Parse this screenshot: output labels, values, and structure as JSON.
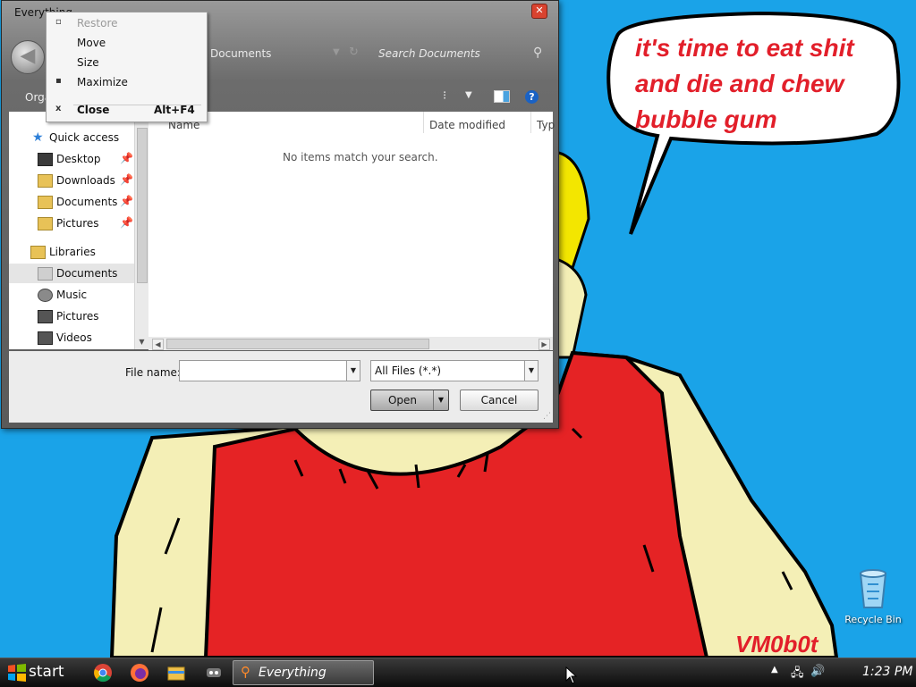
{
  "desktop": {
    "speech_bubble": [
      "it's time to eat shit",
      "and die and chew",
      "bubble gum"
    ],
    "watermark": "VM0b0t",
    "recycle_bin_label": "Recycle Bin"
  },
  "dialog": {
    "title": "Everything",
    "address": "Documents",
    "search_placeholder": "Search Documents",
    "organize_label": "Orga",
    "nav": [
      {
        "label": "Quick access",
        "icon": "star-icon"
      },
      {
        "label": "Desktop",
        "icon": "desktop-icon",
        "pinned": true
      },
      {
        "label": "Downloads",
        "icon": "downloads-icon",
        "pinned": true
      },
      {
        "label": "Documents",
        "icon": "documents-icon",
        "pinned": true
      },
      {
        "label": "Pictures",
        "icon": "pictures-icon",
        "pinned": true
      },
      {
        "label": "Libraries",
        "icon": "libraries-icon"
      },
      {
        "label": "Documents",
        "icon": "documents-library-icon",
        "selected": true
      },
      {
        "label": "Music",
        "icon": "music-icon"
      },
      {
        "label": "Pictures",
        "icon": "pictures-library-icon"
      },
      {
        "label": "Videos",
        "icon": "videos-icon"
      }
    ],
    "columns": [
      "Name",
      "Date modified",
      "Typ"
    ],
    "empty_message": "No items match your search.",
    "file_name_label": "File name:",
    "file_name_value": "",
    "file_type": "All Files (*.*)",
    "open_label": "Open",
    "cancel_label": "Cancel"
  },
  "system_menu": {
    "items": [
      {
        "label": "Restore",
        "disabled": true,
        "glyph": "▫"
      },
      {
        "label": "Move"
      },
      {
        "label": "Size"
      },
      {
        "label": "Maximize",
        "glyph": "▪"
      },
      {
        "label": "Close",
        "shortcut": "Alt+F4",
        "glyph": "x",
        "bold": true
      }
    ]
  },
  "taskbar": {
    "start_label": "start",
    "active_task": "Everything",
    "clock": "1:23 PM"
  }
}
